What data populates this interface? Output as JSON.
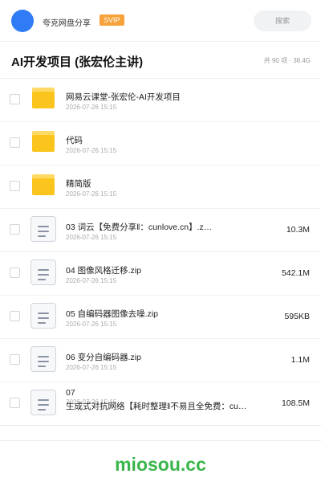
{
  "header": {
    "account_name": "夸克网盘分享",
    "badge": "SVIP",
    "search_placeholder": "搜索"
  },
  "folder_title": "AI开发项目 (张宏伦主讲)",
  "summary": "共 90 项 · 38.4G",
  "items": [
    {
      "type": "folder",
      "name": "网易云课堂-张宏伦-AI开发项目",
      "date": "2026-07-26 15:15",
      "size": ""
    },
    {
      "type": "folder",
      "name": "代码",
      "date": "2026-07-26 15:15",
      "size": ""
    },
    {
      "type": "folder",
      "name": "精简版",
      "date": "2026-07-26 15:15",
      "size": ""
    },
    {
      "type": "file",
      "name": "03 词云【免费分享‖：cunlove.cn】.z…",
      "date": "2026-07-26 15:15",
      "size": "10.3M"
    },
    {
      "type": "file",
      "name": "04 图像风格迁移.zip",
      "date": "2026-07-26 15:15",
      "size": "542.1M"
    },
    {
      "type": "file",
      "name": "05 自编码器图像去噪.zip",
      "date": "2026-07-26 15:15",
      "size": "595KB"
    },
    {
      "type": "file",
      "name": "06 变分自编码器.zip",
      "date": "2026-07-26 15:15",
      "size": "1.1M"
    },
    {
      "type": "file",
      "name_line1": "07",
      "name_line2": "生成式对抗网络【耗时整理‖不易且全免费：cu…",
      "date": "2026-07-26 15:15",
      "size": "108.5M"
    }
  ],
  "watermark": "miosou.cc",
  "colors": {
    "avatar": "#2f7cf6",
    "svip_badge": "#f7a23b",
    "folder": "#fbc51e",
    "watermark": "#39b54a"
  }
}
